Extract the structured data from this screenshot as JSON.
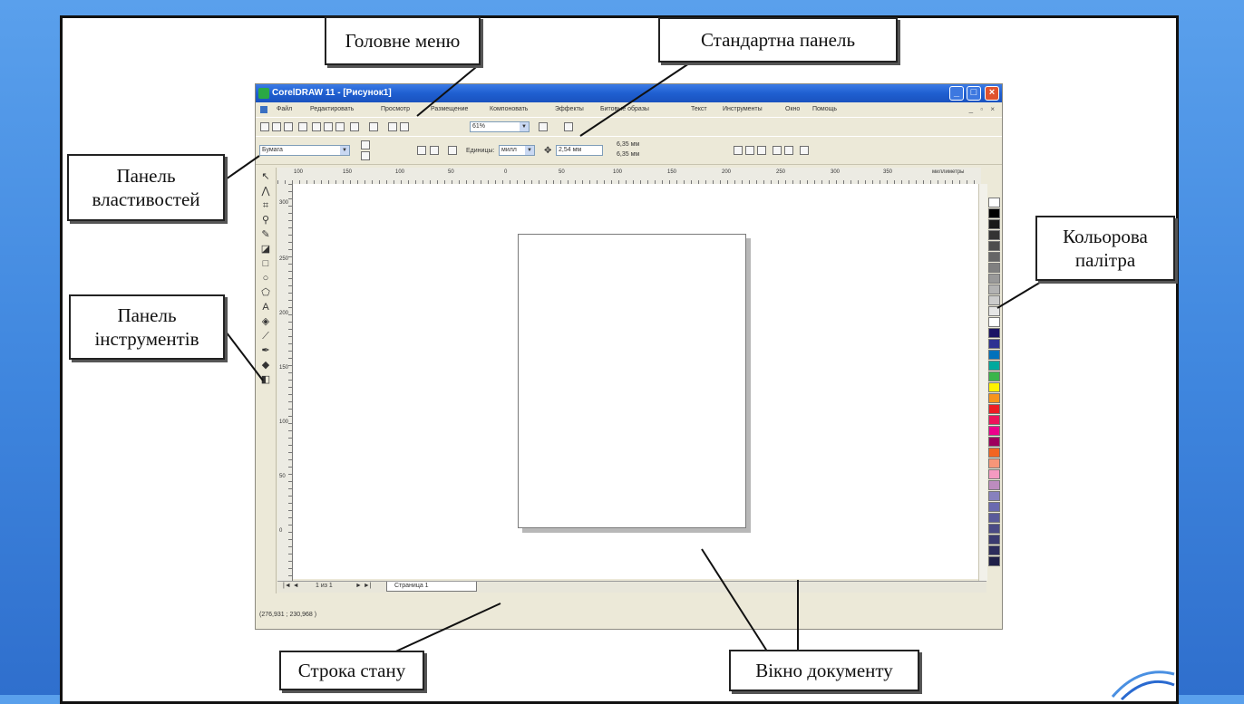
{
  "window": {
    "title": "CorelDRAW 11 - [Рисунок1]",
    "controls": {
      "minimize": "_",
      "maximize": "□",
      "close": "×"
    }
  },
  "menu": [
    "Файл",
    "Редактировать",
    "Просмотр",
    "Размещение",
    "Компоновать",
    "Эффекты",
    "Битовые образы",
    "Текст",
    "Инструменты",
    "Окно",
    "Помощь"
  ],
  "standard_toolbar": {
    "zoom": "61%"
  },
  "property_bar": {
    "paper": "Бумага",
    "units_label": "Единицы:",
    "units_value": "милл",
    "nudge": "2,54 мм",
    "dup_x": "6,35 мм",
    "dup_y": "6,35 мм"
  },
  "ruler": {
    "h_ticks": [
      "100",
      "150",
      "100",
      "50",
      "0",
      "50",
      "100",
      "150",
      "200",
      "250",
      "300",
      "350"
    ],
    "h_unit": "миллиметры",
    "v_ticks": [
      "300",
      "250",
      "200",
      "150",
      "100",
      "50",
      "0"
    ]
  },
  "pagebar": {
    "first": "|◄ ◄",
    "counter": "1 из 1",
    "next": "► ►|",
    "tab": "Страница 1"
  },
  "status": {
    "coords": "(276,931 ; 230,968 )"
  },
  "palette": [
    "#ffffff",
    "#000000",
    "#1a1a1a",
    "#333333",
    "#4d4d4d",
    "#666666",
    "#808080",
    "#999999",
    "#b3b3b3",
    "#cccccc",
    "#e6e6e6",
    "#ffffff",
    "#1b1464",
    "#2e3192",
    "#0071bc",
    "#00a99d",
    "#39b54a",
    "#fff200",
    "#f7941d",
    "#ed1c24",
    "#ed145b",
    "#ec008c",
    "#9e005d",
    "#f26522",
    "#f69679",
    "#f49ac1",
    "#bd8cbf",
    "#8781bd",
    "#6a6ab0",
    "#5a5a9a",
    "#4a4a85",
    "#3a3a70",
    "#2c2c5c",
    "#1f1f48"
  ],
  "callouts": {
    "main_menu": "Головне меню",
    "standard_panel": "Стандартна  панель",
    "property_panel": "Панель властивостей",
    "color_palette": "Кольорова палітра",
    "toolbox": "Панель інструментів",
    "status_bar": "Строка стану",
    "doc_window": "Вікно документу"
  }
}
